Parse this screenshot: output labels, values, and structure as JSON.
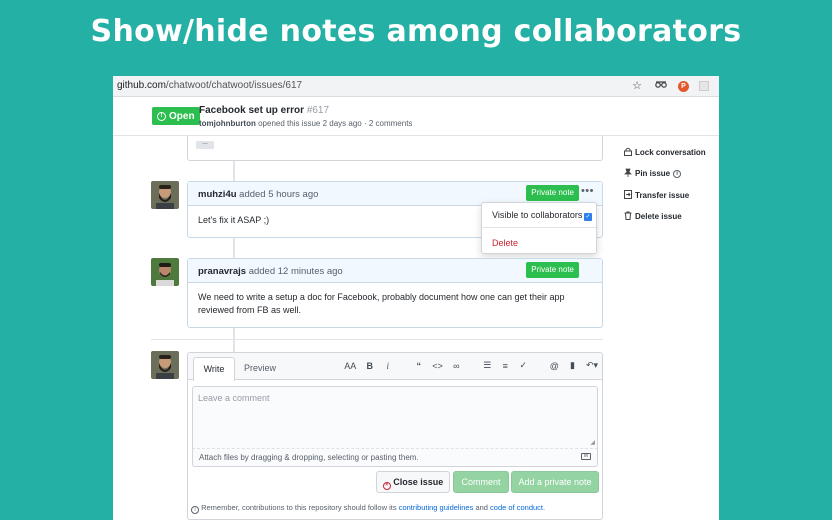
{
  "headline": "Show/hide notes among collaborators",
  "browser": {
    "url_host": "github.com",
    "url_path": "/chatwoot/chatwoot/issues/617",
    "profile_initial": "P"
  },
  "issue": {
    "status": "Open",
    "title": "Facebook set up error",
    "number": "#617",
    "author": "tomjohnburton",
    "meta": "opened this issue 2 days ago · 2 comments"
  },
  "comments": [
    {
      "author": "muhzi4u",
      "time": "added 5 hours ago",
      "badge": "Private note",
      "body": "Let's fix it ASAP ;)"
    },
    {
      "author": "pranavrajs",
      "time": "added 12 minutes ago",
      "badge": "Private note",
      "body": "We need to write a setup a doc for Facebook, probably document how one can get their app reviewed from FB as well."
    }
  ],
  "dropdown": {
    "visible_label": "Visible to collaborators",
    "visible_checked": true,
    "delete_label": "Delete"
  },
  "sidebar": {
    "items": [
      {
        "label": "Lock conversation",
        "icon": "lock-icon"
      },
      {
        "label": "Pin issue",
        "icon": "pin-icon"
      },
      {
        "label": "Transfer issue",
        "icon": "transfer-icon"
      },
      {
        "label": "Delete issue",
        "icon": "trash-icon"
      }
    ]
  },
  "editor": {
    "tab_write": "Write",
    "tab_preview": "Preview",
    "placeholder": "Leave a comment",
    "attach_hint": "Attach files by dragging & dropping, selecting or pasting them.",
    "close_label": "Close issue",
    "comment_label": "Comment",
    "private_label": "Add a private note"
  },
  "footnote": {
    "prefix": "Remember, contributions to this repository should follow its",
    "link1": "contributing guidelines",
    "and": "and",
    "link2": "code of conduct",
    "suffix": "."
  },
  "colors": {
    "background": "#24b0a4",
    "open_green": "#2cbe4e",
    "private_green": "#2cbe4e",
    "link_blue": "#0366d6",
    "delete_red": "#cb2431"
  }
}
